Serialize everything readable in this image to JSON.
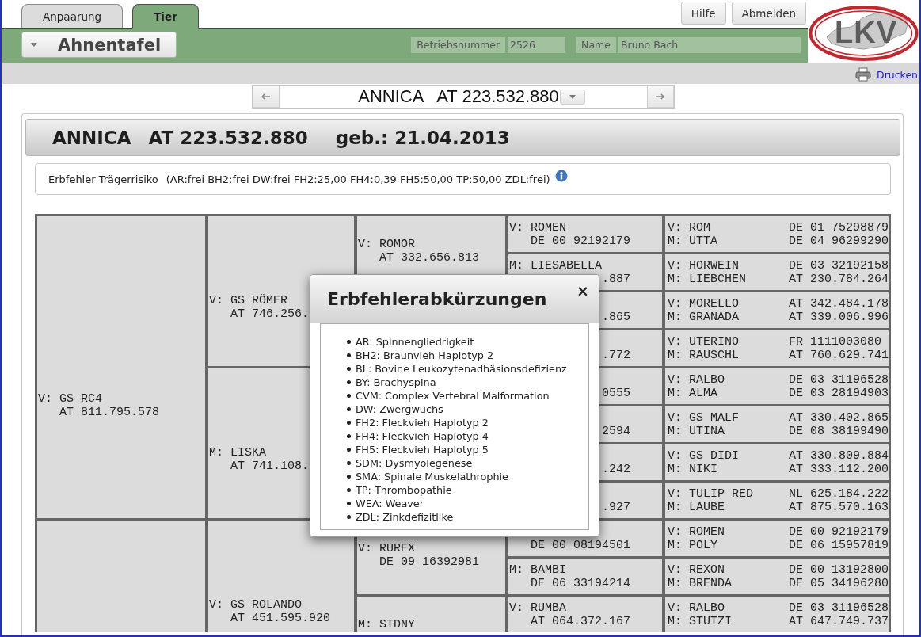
{
  "tabs": [
    {
      "label": "Anpaarung",
      "selected": false
    },
    {
      "label": "Tier",
      "selected": true
    }
  ],
  "header_buttons": [
    {
      "label": "Hilfe"
    },
    {
      "label": "Abmelden"
    }
  ],
  "logo": {
    "text": "LKV"
  },
  "view_menu": {
    "label": "Ahnentafel"
  },
  "farm_fields": [
    {
      "label": "Betriebsnummer",
      "value": "2526"
    },
    {
      "label": "Name",
      "value": "Bruno Bach"
    }
  ],
  "print_link": {
    "label": "Drucken"
  },
  "navigator": {
    "animal": "ANNICA   AT 223.532.880"
  },
  "animal": {
    "name": "ANNICA",
    "ear_tag": "AT 223.532.880",
    "birth": "geb.: 21.04.2013"
  },
  "carrier_risk": {
    "label": "Erbfehler Trägerrisiko",
    "values": "(AR:frei BH2:frei DW:frei FH2:25,00 FH4:0,39 FH5:50,00 TP:50,00 ZDL:frei)"
  },
  "pedigree": [
    {
      "name": "V: GS RC4",
      "id": "AT 811.795.578",
      "children": [
        {
          "name": "V: GS RÖMER",
          "id": "AT 746.256.",
          "children": [
            {
              "name": "V: ROMOR",
              "id": "AT 332.656.813",
              "children": [
                {
                  "name": "V: ROMEN",
                  "id": "DE 00 92192179",
                  "children": [
                    {
                      "name": "V: ROM",
                      "id": "DE 01 75298879"
                    },
                    {
                      "name": "M: UTTA",
                      "id": "DE 04 96299290"
                    }
                  ]
                },
                {
                  "name": "M: LIESABELLA",
                  "id": ".887",
                  "start_covered": true,
                  "children": [
                    {
                      "name": "V: HORWEIN",
                      "id": "DE 03 32192158"
                    },
                    {
                      "name": "M: LIEBCHEN",
                      "id": "AT 230.784.264"
                    }
                  ]
                }
              ]
            },
            {
              "children": [
                {
                  "id": ".865",
                  "start_covered": true,
                  "children": [
                    {
                      "name": "V: MORELLO",
                      "id": "AT 342.484.178"
                    },
                    {
                      "name": "M: GRANADA",
                      "id": "AT 339.006.996"
                    }
                  ]
                },
                {
                  "id": ".772",
                  "start_covered": true,
                  "children": [
                    {
                      "name": "V: UTERINO",
                      "id": "FR 1111003080"
                    },
                    {
                      "name": "M: RAUSCHL",
                      "id": "AT 760.629.741"
                    }
                  ]
                }
              ]
            }
          ]
        },
        {
          "name": "M: LISKA",
          "id": "AT 741.108.",
          "children": [
            {
              "children": [
                {
                  "id": "0555",
                  "start_covered": true,
                  "children": [
                    {
                      "name": "V: RALBO",
                      "id": "DE 03 31196528"
                    },
                    {
                      "name": "M: ALMA",
                      "id": "DE 03 28194903"
                    }
                  ]
                },
                {
                  "id": "2594",
                  "start_covered": true,
                  "children": [
                    {
                      "name": "V: GS MALF",
                      "id": "AT 330.402.865"
                    },
                    {
                      "name": "M: UTINA",
                      "id": "DE 08 38199490"
                    }
                  ]
                }
              ]
            },
            {
              "children": [
                {
                  "id": ".242",
                  "start_covered": true,
                  "children": [
                    {
                      "name": "V: GS DIDI",
                      "id": "AT 330.809.884"
                    },
                    {
                      "name": "M: NIKI",
                      "id": "AT 333.112.200"
                    }
                  ]
                },
                {
                  "id": ".927",
                  "start_covered": true,
                  "children": [
                    {
                      "name": "V: TULIP RED",
                      "id": "NL 625.184.222"
                    },
                    {
                      "name": "M: LAUBE",
                      "id": "AT 875.570.163"
                    }
                  ]
                }
              ]
            }
          ]
        }
      ]
    },
    {
      "children": [
        {
          "name": "V: GS ROLANDO",
          "id": "AT 451.595.920",
          "children": [
            {
              "name": "V: RUREX",
              "id": "DE 09 16392981",
              "children": [
                {
                  "id": "DE 00 08194501",
                  "children": [
                    {
                      "name": "V: ROMEN",
                      "id": "DE 00 92192179"
                    },
                    {
                      "name": "M: POLY",
                      "id": "DE 06 15957819"
                    }
                  ]
                },
                {
                  "name": "M: BAMBI",
                  "id": "DE 06 33194214",
                  "children": [
                    {
                      "name": "V: REXON",
                      "id": "DE 00 13192800"
                    },
                    {
                      "name": "M: BRENDA",
                      "id": "DE 05 34196280"
                    }
                  ]
                }
              ]
            },
            {
              "name": "M: SIDNY",
              "children": [
                {
                  "name": "V: RUMBA",
                  "id": "AT 064.372.167",
                  "children": [
                    {
                      "name": "V: RALBO",
                      "id": "DE 03 31196528"
                    },
                    {
                      "name": "M: STUTZI",
                      "id": "AT 647.749.737"
                    }
                  ]
                }
              ]
            }
          ]
        }
      ]
    }
  ],
  "dialog": {
    "title": "Erbfehlerabkürzungen",
    "close": "×",
    "items": [
      "AR: Spinnengliedrigkeit",
      "BH2: Braunvieh Haplotyp 2",
      "BL: Bovine Leukozytenadhäsionsdefizienz",
      "BY: Brachyspina",
      "CVM: Complex Vertebral Malformation",
      "DW: Zwergwuchs",
      "FH2: Fleckvieh Haplotyp 2",
      "FH4: Fleckvieh Haplotyp 4",
      "FH5: Fleckvieh Haplotyp 5",
      "SDM: Dysmyolegenese",
      "SMA: Spinale Muskelathrophie",
      "TP: Thrombopathie",
      "WEA: Weaver",
      "ZDL: Zinkdefizitlike"
    ]
  }
}
